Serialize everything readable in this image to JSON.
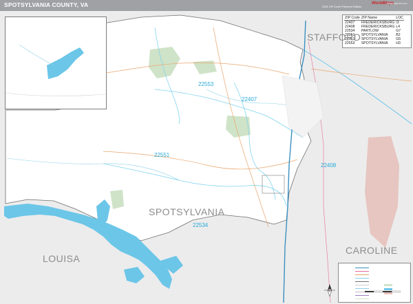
{
  "header": {
    "title": "SPOTSYLVANIA COUNTY, VA",
    "edition": "2021 ZIP Code Premium Edition",
    "brand": "WorldMaps",
    "brand_sub": "Market Maps Premium"
  },
  "neighbors": {
    "stafford": "STAFFORD",
    "caroline": "CAROLINE",
    "louisa": "LOUISA",
    "county_label": "SPOTSYLVANIA"
  },
  "zip_labels": {
    "z22553": "22553",
    "z22407": "22407",
    "z22551": "22551",
    "z22408": "22408",
    "z22534": "22534"
  },
  "zip_table": {
    "headers": [
      "ZIP Code",
      "ZIP Name",
      "LOC"
    ],
    "rows": [
      [
        "22407",
        "FREDERICKSBURG",
        "I3"
      ],
      [
        "22408",
        "FREDERICKSBURG",
        "L4"
      ],
      [
        "22534",
        "PARTLOW",
        "G7"
      ],
      [
        "22551",
        "SPOTSYLVANIA",
        "B2"
      ],
      [
        "22551",
        "SPOTSYLVANIA",
        "G5"
      ],
      [
        "22553",
        "SPOTSYLVANIA",
        "H3"
      ]
    ]
  },
  "colors": {
    "titlebar": "#9fa1a4",
    "water": "#6cc6e8",
    "zip_label": "#25a8d8",
    "park": "#cfe3c8",
    "neighbor_fill": "#ececec",
    "zip_boundary": "#7fd3ee",
    "highway": "#3a8fc0",
    "major_road": "#e9a46a"
  },
  "icons": {
    "compass": "north-arrow-icon"
  }
}
